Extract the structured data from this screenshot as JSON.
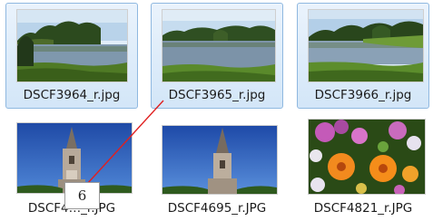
{
  "files": [
    {
      "name": "DSCF3964_r.jpg",
      "selected": true
    },
    {
      "name": "DSCF3965_r.jpg",
      "selected": true
    },
    {
      "name": "DSCF3966_r.jpg",
      "selected": true
    },
    {
      "name": "DSCF4…_r.JPG",
      "selected": false
    },
    {
      "name": "DSCF4695_r.JPG",
      "selected": false
    },
    {
      "name": "DSCF4821_r.JPG",
      "selected": false
    }
  ],
  "callout": {
    "label": "6"
  }
}
